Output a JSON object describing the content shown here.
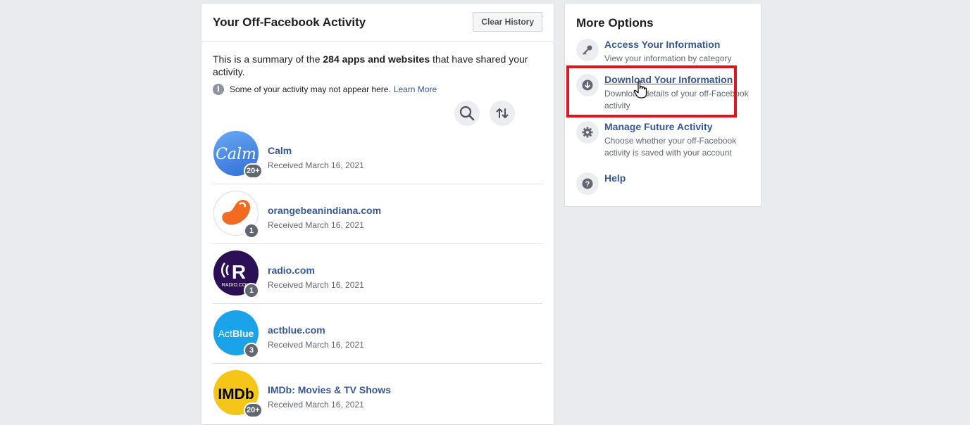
{
  "main": {
    "title": "Your Off-Facebook Activity",
    "clear_history_label": "Clear History",
    "summary_pre": "This is a summary of the ",
    "summary_bold": "284 apps and websites",
    "summary_post": " that have shared your activity.",
    "notice_text": "Some of your activity may not appear here.",
    "learn_more": "Learn More",
    "info_icon_glyph": "i",
    "apps": [
      {
        "name": "Calm",
        "received": "Received March 16, 2021",
        "count": "20+",
        "logo_text": "Calm",
        "logo_color": "#3a86e6",
        "icon": "calm-logo"
      },
      {
        "name": "orangebeanindiana.com",
        "received": "Received March 16, 2021",
        "count": "1",
        "logo_text": "",
        "logo_color": "#f26b21",
        "icon": "orange-bean-logo"
      },
      {
        "name": "radio.com",
        "received": "Received March 16, 2021",
        "count": "1",
        "logo_text": "R",
        "logo_sub": "RADIO.COM",
        "logo_color": "#2b1055",
        "icon": "radio-logo"
      },
      {
        "name": "actblue.com",
        "received": "Received March 16, 2021",
        "count": "3",
        "logo_text_a": "Act",
        "logo_text_b": "Blue",
        "logo_color": "#1aa3e8",
        "icon": "actblue-logo"
      },
      {
        "name": "IMDb: Movies & TV Shows",
        "received": "Received March 16, 2021",
        "count": "20+",
        "logo_text": "IMDb",
        "logo_color": "#f5c518",
        "icon": "imdb-logo"
      }
    ]
  },
  "side": {
    "title": "More Options",
    "options": [
      {
        "title": "Access Your Information",
        "desc": "View your information by category",
        "icon": "key-icon"
      },
      {
        "title": "Download Your Information",
        "desc": "Download details of your off-Facebook activity",
        "icon": "download-icon"
      },
      {
        "title": "Manage Future Activity",
        "desc": "Choose whether your off-Facebook activity is saved with your account",
        "icon": "gear-icon"
      },
      {
        "title": "Help",
        "desc": "",
        "icon": "help-icon"
      }
    ]
  },
  "colors": {
    "link": "#365899",
    "highlight": "#e0141e",
    "background": "#e9ebee"
  }
}
